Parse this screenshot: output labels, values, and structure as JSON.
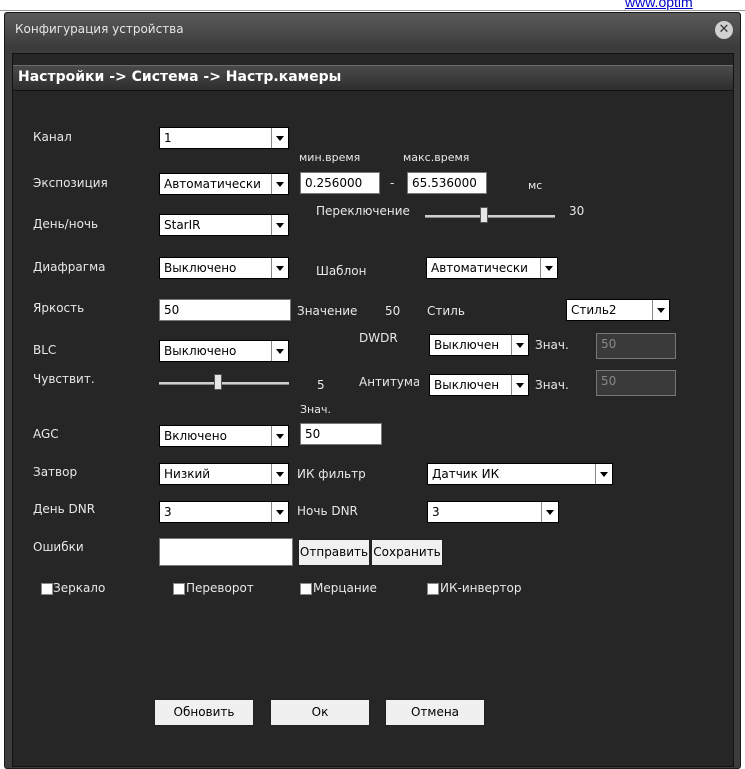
{
  "site_link": "www.optim",
  "window": {
    "title": "Конфигурация устройства",
    "close_glyph": "✕"
  },
  "header": "Настройки -> Система -> Настр.камеры",
  "fields": {
    "channel": {
      "label": "Канал",
      "value": "1"
    },
    "min_time_label": "мин.время",
    "max_time_label": "макс.время",
    "exposure": {
      "label": "Экспозиция",
      "value": "Автоматически",
      "min": "0.256000",
      "dash": "-",
      "max": "65.536000",
      "unit": "мс"
    },
    "daynight": {
      "label": "День/ночь",
      "value": "StarIR",
      "switch_label": "Переключение",
      "switch_value": "30"
    },
    "aperture": {
      "label": "Диафрагма",
      "value": "Выключено",
      "template_label": "Шаблон",
      "template_value": "Автоматически"
    },
    "brightness": {
      "label": "Яркость",
      "value": "50",
      "value_label": "Значение",
      "value_num": "50",
      "style_label": "Стиль",
      "style_value": "Стиль2"
    },
    "blc": {
      "label": "BLC",
      "value": "Выключено",
      "dwdr_label": "DWDR",
      "dwdr_value": "Выключен",
      "dwdr_znach": "Знач.",
      "dwdr_num": "50"
    },
    "sensitivity": {
      "label": "Чувствит.",
      "slider_value": "5",
      "antifog_label": "Антитума",
      "antifog_value": "Выключен",
      "antifog_znach": "Знач.",
      "antifog_num": "50"
    },
    "agc": {
      "label": "AGC",
      "value": "Включено",
      "znach_label": "Знач.",
      "znach_value": "50"
    },
    "shutter": {
      "label": "Затвор",
      "value": "Низкий",
      "ir_filter_label": "ИК фильтр",
      "ir_filter_value": "Датчик ИК"
    },
    "day_dnr": {
      "label": "День DNR",
      "value": "3",
      "night_label": "Ночь DNR",
      "night_value": "3"
    },
    "errors": {
      "label": "Ошибки",
      "value": "",
      "send": "Отправить",
      "save": "Сохранить"
    }
  },
  "checkboxes": [
    {
      "label": "Зеркало"
    },
    {
      "label": "Переворот"
    },
    {
      "label": "Мерцание"
    },
    {
      "label": "ИК-инвертор"
    }
  ],
  "buttons": {
    "refresh": "Обновить",
    "ok": "Ок",
    "cancel": "Отмена"
  },
  "levels": {
    "switch_slider_fraction": 0.45,
    "sensitivity_slider_fraction": 0.45
  },
  "colors": {
    "window_bg": "#3c3c3c",
    "panel_bg": "#262626",
    "text": "#e8e8e8",
    "link": "#0000cc"
  }
}
